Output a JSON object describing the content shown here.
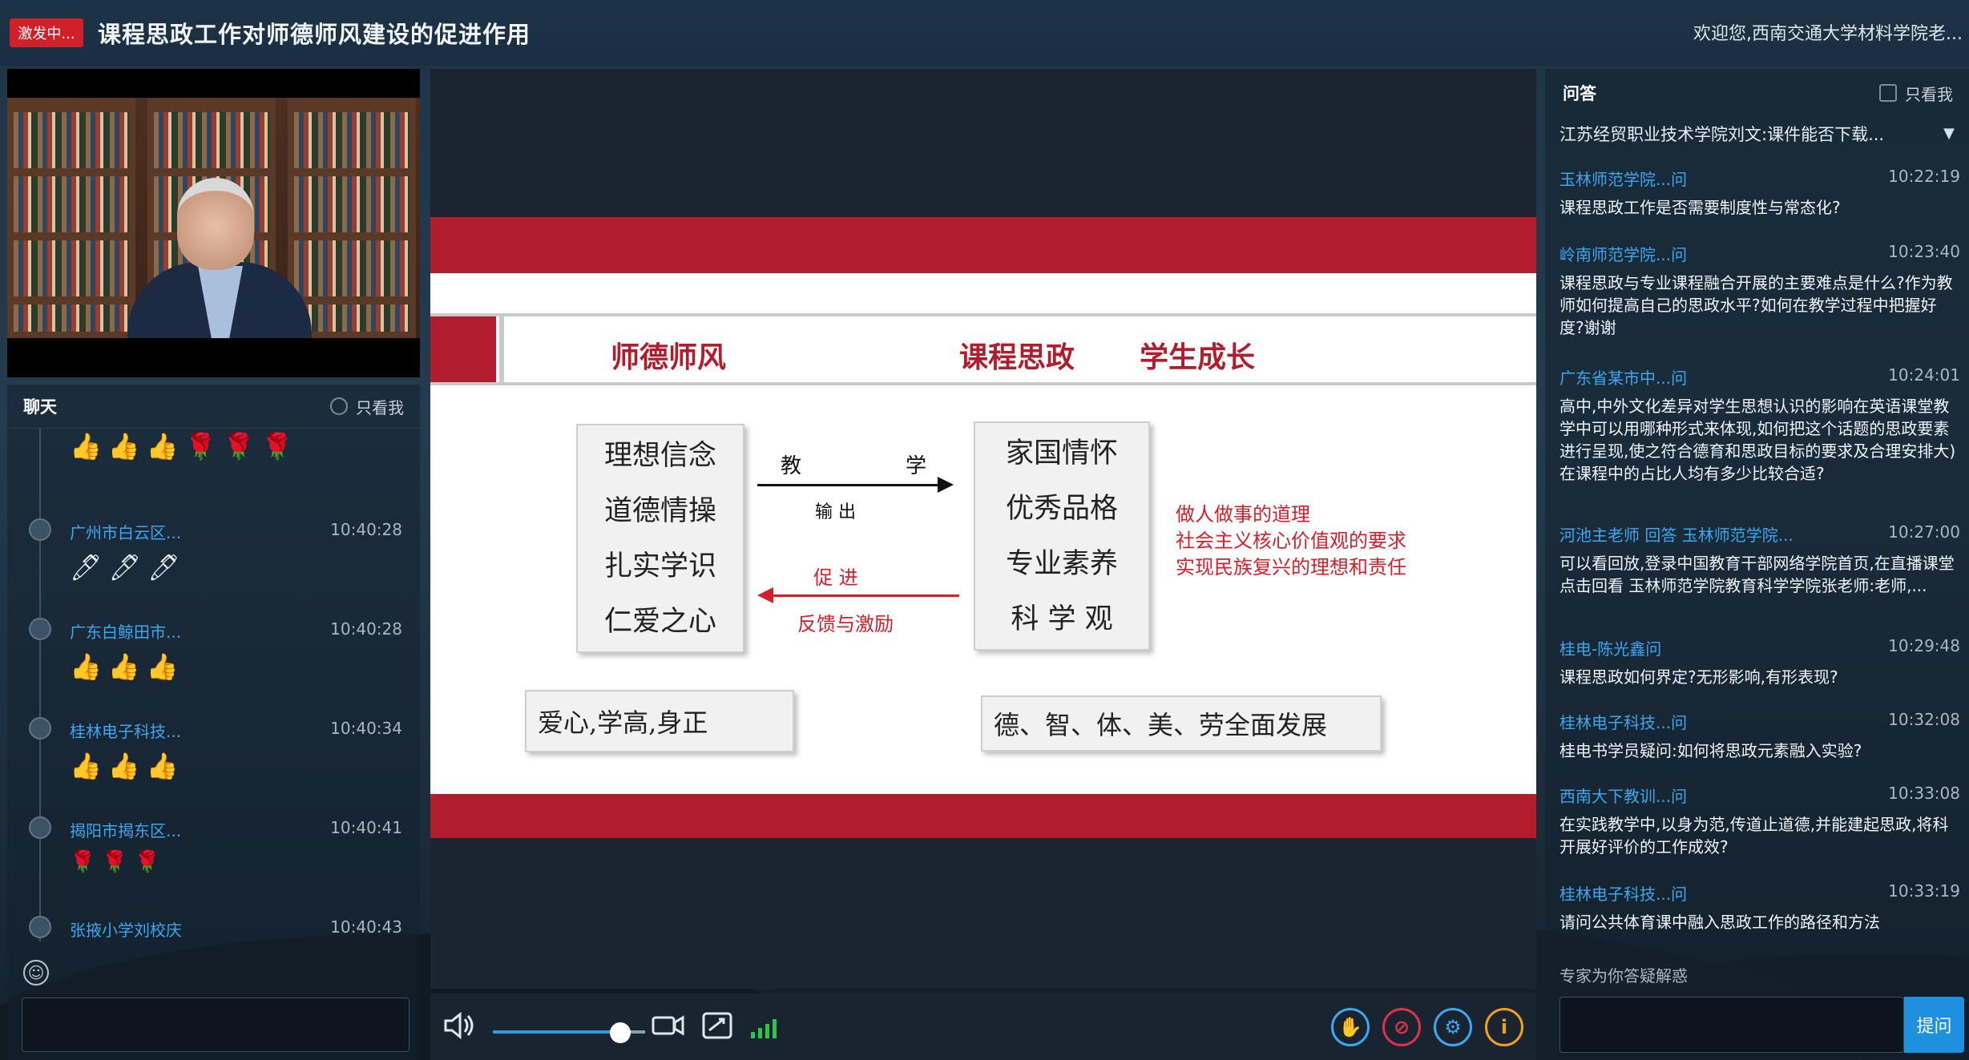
{
  "topbar": {
    "live_badge": "激发中...",
    "title": "课程思政工作对师德师风建设的促进作用",
    "welcome": "欢迎您,西南交通大学材料学院老..."
  },
  "chat": {
    "title": "聊天",
    "only_me": "只看我",
    "items": [
      {
        "name": "",
        "time": "",
        "emojis": "👍👍👍🌹🌹🌹"
      },
      {
        "name": "广州市白云区...",
        "time": "10:40:28",
        "emojis": "🖊🖊🖊"
      },
      {
        "name": "广东白鲸田市...",
        "time": "10:40:28",
        "emojis": "👍👍👍"
      },
      {
        "name": "桂林电子科技...",
        "time": "10:40:34",
        "emojis": "👍👍👍"
      },
      {
        "name": "揭阳市揭东区...",
        "time": "10:40:41",
        "emojis": "🌹🌹🌹"
      },
      {
        "name": "张掖小学刘校庆",
        "time": "10:40:43",
        "emojis": ""
      }
    ],
    "input_placeholder": ""
  },
  "slide": {
    "header": {
      "left": "师德师风",
      "mid": "课程思政",
      "right": "学生成长"
    },
    "left_box": [
      "理想信念",
      "道德情操",
      "扎实学识",
      "仁爱之心"
    ],
    "right_box": [
      "家国情怀",
      "优秀品格",
      "专业素养",
      "科 学 观"
    ],
    "arrow_top_label_left": "教",
    "arrow_top_label_right": "学",
    "arrow_top_sub": "输  出",
    "arrow_bottom_label": "促  进",
    "arrow_bottom_sub": "反馈与激励",
    "red_note": [
      "做人做事的道理",
      "社会主义核心价值观的要求",
      "实现民族复兴的理想和责任"
    ],
    "bottom_left": "爱心,学高,身正",
    "bottom_right": "德、智、体、美、劳全面发展"
  },
  "qa": {
    "title": "问答",
    "only_me": "只看我",
    "top_line": "江苏经贸职业技术学院刘文:课件能否下载...",
    "items": [
      {
        "name": "玉林师范学院...问",
        "time": "10:22:19",
        "text": "课程思政工作是否需要制度性与常态化?"
      },
      {
        "name": "岭南师范学院...问",
        "time": "10:23:40",
        "text": "课程思政与专业课程融合开展的主要难点是什么?作为教师如何提高自己的思政水平?如何在教学过程中把握好度?谢谢"
      },
      {
        "name": "广东省某市中...问",
        "time": "10:24:01",
        "text": "高中,中外文化差异对学生思想认识的影响在英语课堂教学中可以用哪种形式来体现,如何把这个话题的思政要素进行呈现,使之符合德育和思政目标的要求及合理安排大)在课程中的占比人均有多少比较合适?"
      },
      {
        "name": "河池主老师 回答 玉林师范学院...",
        "time": "10:27:00",
        "text": "可以看回放,登录中国教育干部网络学院首页,在直播课堂点击回看 玉林师范学院教育科学学院张老师:老师,..."
      },
      {
        "name": "桂电-陈光鑫问",
        "time": "10:29:48",
        "text": "课程思政如何界定?无形影响,有形表现?"
      },
      {
        "name": "桂林电子科技...问",
        "time": "10:32:08",
        "text": "桂电书学员疑问:如何将思政元素融入实验?"
      },
      {
        "name": "西南大下教训...问",
        "time": "10:33:08",
        "text": "在实践教学中,以身为范,传道止道德,并能建起思政,将科开展好评价的工作成效?"
      },
      {
        "name": "桂林电子科技...问",
        "time": "10:33:19",
        "text": "请问公共体育课中融入思政工作的路径和方法"
      }
    ],
    "hint": "专家为你答疑解惑",
    "send_label": "提问"
  },
  "controls": {
    "volume_level": 0.82
  },
  "colors": {
    "accent": "#1f8fe0",
    "slide_red": "#b21d2e",
    "link_blue": "#3fa6f0"
  }
}
